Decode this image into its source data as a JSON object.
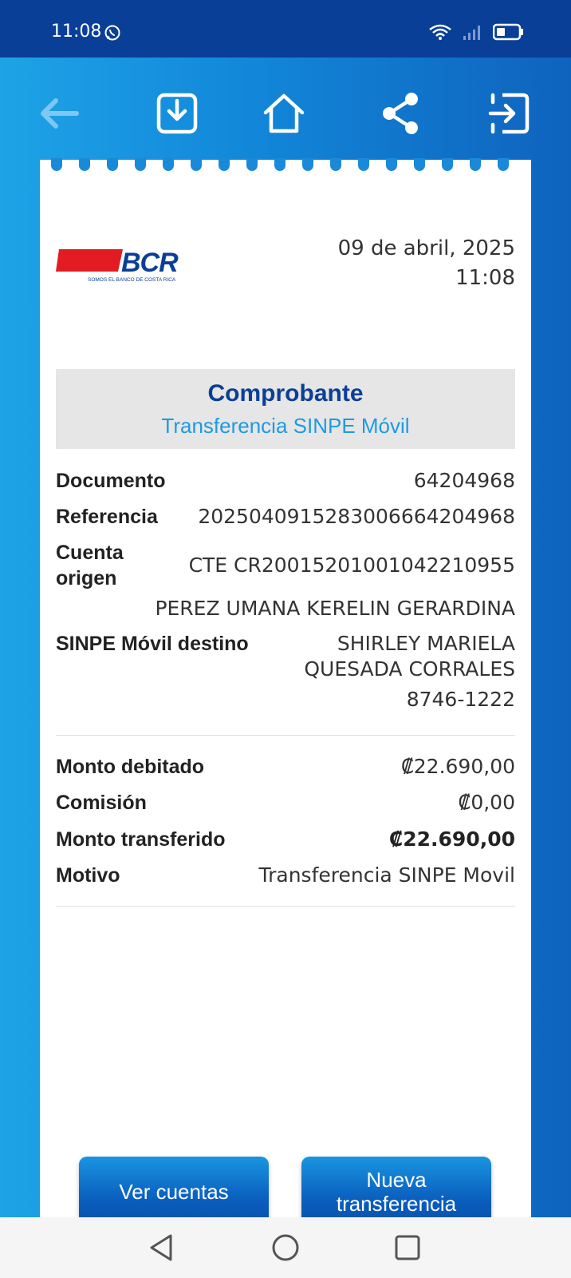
{
  "status_bar": {
    "time": "11:08",
    "icons": [
      "whatsapp-icon",
      "wifi-icon",
      "signal-icon",
      "battery-icon"
    ]
  },
  "toolbar": {
    "icons": [
      "back-arrow-icon",
      "download-icon",
      "home-icon",
      "share-icon",
      "exit-icon"
    ]
  },
  "header": {
    "logo_text": "BCR",
    "logo_tagline": "SOMOS EL BANCO DE COSTA RICA",
    "date": "09 de abril, 2025",
    "time": "11:08"
  },
  "title": {
    "main": "Comprobante",
    "sub": "Transferencia SINPE Móvil"
  },
  "details": {
    "documento_label": "Documento",
    "documento_value": "64204968",
    "referencia_label": "Referencia",
    "referencia_value": "2025040915283006664204968",
    "cuenta_label_1": "Cuenta",
    "cuenta_label_2": "origen",
    "cuenta_value": "CTE CR20015201001042210955",
    "cuenta_holder": "PEREZ UMANA KERELIN GERARDINA",
    "destino_label": "SINPE Móvil destino",
    "destino_name_1": "SHIRLEY MARIELA",
    "destino_name_2": "QUESADA CORRALES",
    "destino_phone": "8746-1222"
  },
  "amounts": {
    "debitado_label": "Monto debitado",
    "debitado_value": "₡22.690,00",
    "comision_label": "Comisión",
    "comision_value": "₡0,00",
    "transferido_label": "Monto transferido",
    "transferido_value": "₡22.690,00",
    "motivo_label": "Motivo",
    "motivo_value": "Transferencia SINPE Movil"
  },
  "buttons": {
    "ver_cuentas": "Ver cuentas",
    "nueva_1": "Nueva",
    "nueva_2": "transferencia"
  },
  "colors": {
    "primary": "#0b3f96",
    "accent": "#1f9ae0",
    "bcr_red": "#e31b23"
  }
}
